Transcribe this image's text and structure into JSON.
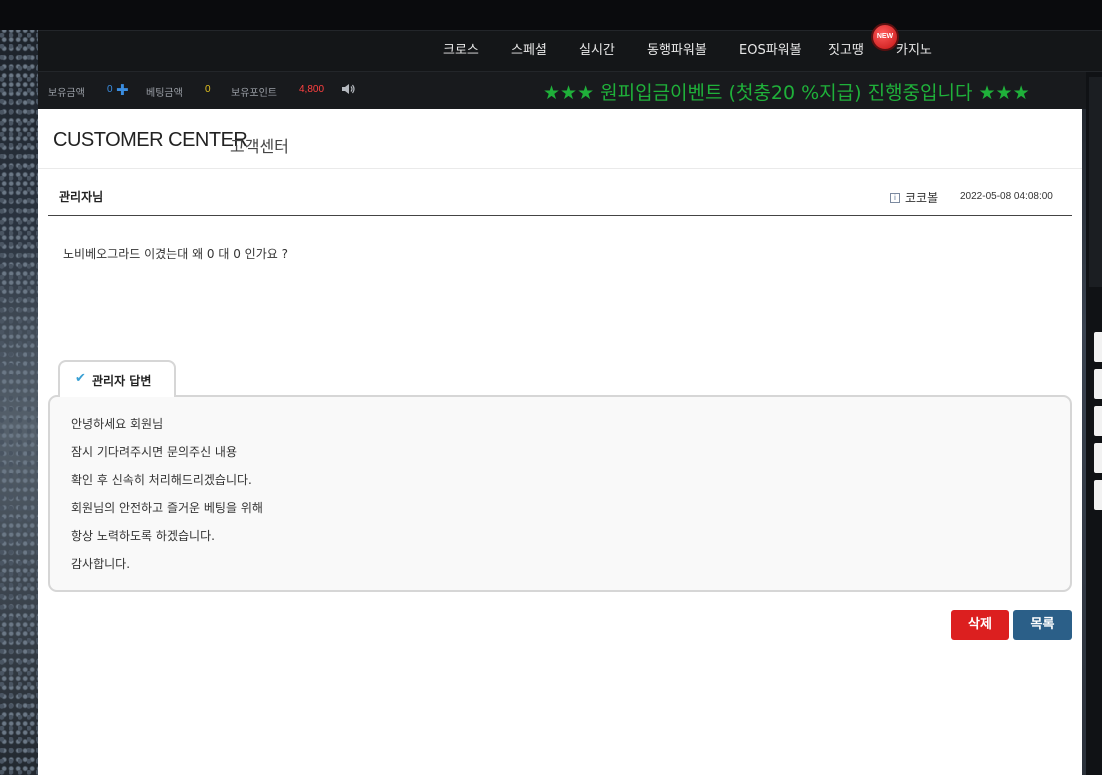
{
  "top_links": [
    "",
    "",
    "",
    "",
    "",
    ""
  ],
  "nav": {
    "items": [
      "크로스",
      "스페셜",
      "실시간",
      "동행파워볼",
      "EOS파워볼",
      "짓고땡",
      "카지노"
    ],
    "new_badge": "NEW"
  },
  "info": {
    "balance_label": "보유금액",
    "balance_value": "0",
    "bet_label": "베팅금액",
    "bet_value": "0",
    "points_label": "보유포인트",
    "points_value": "4,800",
    "marquee": "★★★ 원피입금이벤트 (첫충20 %지급) 진행중입니다 ★★★"
  },
  "page": {
    "title": "CUSTOMER CENTER",
    "subtitle": "고객센터"
  },
  "post": {
    "title": "관리자님",
    "author_icon": "i",
    "author": "코코볼",
    "date": "2022-05-08 04:08:00",
    "body": "노비베오그라드 이겼는대 왜 0 대 0 인가요 ?"
  },
  "reply": {
    "tab_label": "관리자 답변",
    "lines": [
      "안녕하세요 회원님",
      "잠시 기다려주시면 문의주신 내용",
      "확인 후 신속히 처리해드리겠습니다.",
      "회원님의 안전하고 즐거운 베팅을 위해",
      "항상 노력하도록 하겠습니다.",
      "감사합니다."
    ]
  },
  "buttons": {
    "delete": "삭제",
    "list": "목록"
  },
  "colors": {
    "marquee": "#1fb13a",
    "points": "#ff4040",
    "balance": "#3a8de0",
    "bet": "#e0c020",
    "delete": "#dc1f1f",
    "list": "#2b5f88"
  }
}
